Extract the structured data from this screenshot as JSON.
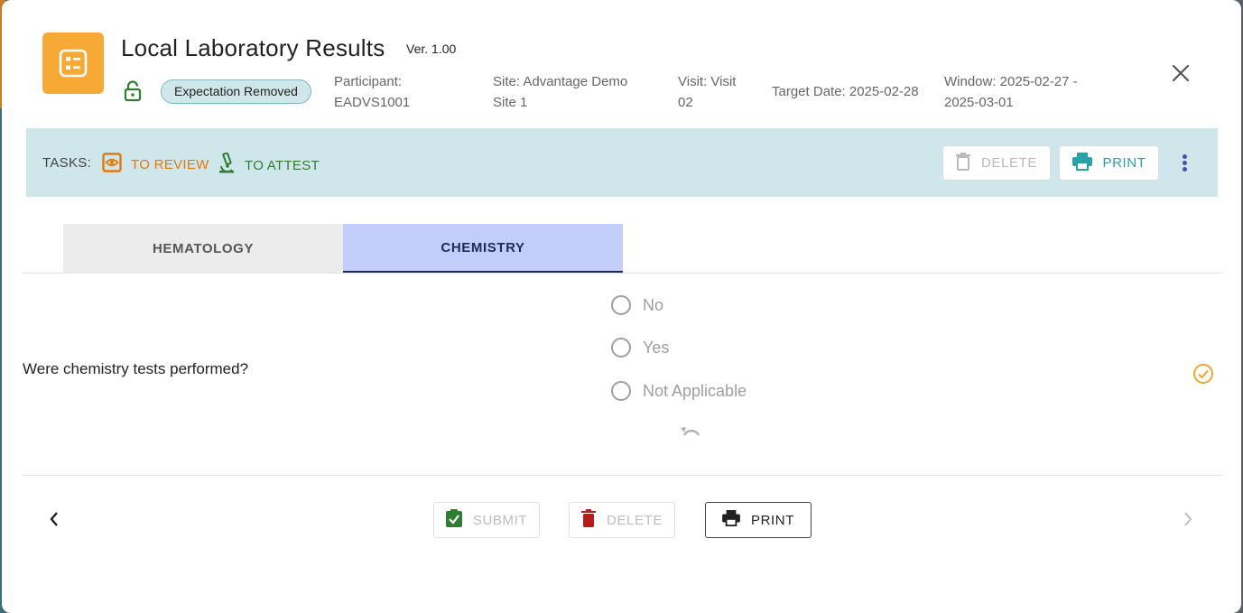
{
  "header": {
    "title": "Local Laboratory Results",
    "version": "Ver. 1.00",
    "status_badge": "Expectation Removed",
    "participant_line1": "Participant:",
    "participant_line2": "EADVS1001",
    "site_line1": "Site: Advantage Demo",
    "site_line2": "Site 1",
    "visit_line1": "Visit: Visit",
    "visit_line2": "02",
    "target_date": "Target Date: 2025-02-28",
    "window_line1": "Window: 2025-02-27 -",
    "window_line2": "2025-03-01",
    "app_icon": "form-list-icon",
    "lock_icon": "unlocked-icon",
    "close_icon": "close-icon"
  },
  "tasks": {
    "label": "TASKS:",
    "review_label": "TO REVIEW",
    "review_icon": "eye-icon",
    "attest_label": "TO ATTEST",
    "attest_icon": "microscope-icon",
    "delete_label": "DELETE",
    "print_label": "PRINT",
    "more_icon": "more-vertical-icon"
  },
  "tabs": [
    {
      "label": "HEMATOLOGY",
      "active": false
    },
    {
      "label": "CHEMISTRY",
      "active": true
    }
  ],
  "question": {
    "text": "Were chemistry tests performed?",
    "options": [
      "No",
      "Yes",
      "Not Applicable"
    ],
    "selected": null,
    "reset_icon": "undo-icon",
    "status_icon": "check-circle-icon"
  },
  "footer": {
    "submit_label": "SUBMIT",
    "delete_label": "DELETE",
    "print_label": "PRINT",
    "prev_icon": "chevron-left-icon",
    "next_icon": "chevron-right-icon"
  },
  "colors": {
    "accent_orange": "#f7a935",
    "task_bar": "#cfe7ea",
    "active_tab": "#c3cdfa",
    "review_orange": "#e07a10",
    "attest_green": "#2e7d32",
    "print_teal": "#2aa0a8"
  }
}
